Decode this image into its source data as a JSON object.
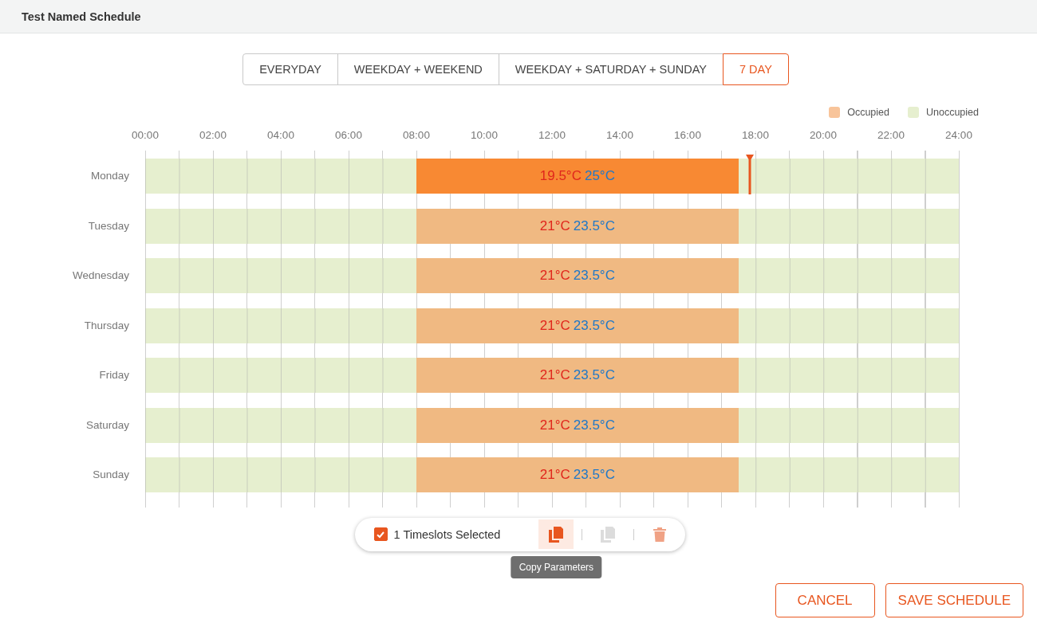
{
  "header": {
    "title": "Test Named Schedule"
  },
  "tabs": [
    {
      "label": "EVERYDAY",
      "selected": false
    },
    {
      "label": "WEEKDAY + WEEKEND",
      "selected": false
    },
    {
      "label": "WEEKDAY + SATURDAY + SUNDAY",
      "selected": false
    },
    {
      "label": "7 DAY",
      "selected": true
    }
  ],
  "legend": [
    {
      "label": "Occupied",
      "color": "#f8c49a"
    },
    {
      "label": "Unoccupied",
      "color": "#e6efcf"
    }
  ],
  "hours": [
    "00:00",
    "02:00",
    "04:00",
    "06:00",
    "08:00",
    "10:00",
    "12:00",
    "14:00",
    "16:00",
    "18:00",
    "20:00",
    "22:00",
    "24:00"
  ],
  "days": [
    {
      "day": "Monday",
      "segments": [
        {
          "kind": "unoccupied",
          "level": 0.333333
        },
        {
          "kind": "occupied",
          "low": "19.5°C",
          "high": "25°C",
          "selected": true
        },
        {
          "kind": "unoccupied",
          "level": 0.270834
        }
      ]
    },
    {
      "day": "Tuesday",
      "segments": [
        {
          "kind": "unoccupied",
          "level": 0.333333
        },
        {
          "kind": "occupied",
          "low": "21°C",
          "high": "23.5°C",
          "selected": false
        },
        {
          "kind": "unoccupied",
          "level": 0.270834
        }
      ]
    },
    {
      "day": "Wednesday",
      "segments": [
        {
          "kind": "unoccupied",
          "level": 0.333333
        },
        {
          "kind": "occupied",
          "low": "21°C",
          "high": "23.5°C",
          "selected": false
        },
        {
          "kind": "unoccupied",
          "level": 0.270834
        }
      ]
    },
    {
      "day": "Thursday",
      "segments": [
        {
          "kind": "unoccupied",
          "level": 0.333333
        },
        {
          "kind": "occupied",
          "low": "21°C",
          "high": "23.5°C",
          "selected": false
        },
        {
          "kind": "unoccupied",
          "level": 0.270834
        }
      ]
    },
    {
      "day": "Friday",
      "segments": [
        {
          "kind": "unoccupied",
          "level": 0.333333
        },
        {
          "kind": "occupied",
          "low": "21°C",
          "high": "23.5°C",
          "selected": false
        },
        {
          "kind": "unoccupied",
          "level": 0.270834
        }
      ]
    },
    {
      "day": "Saturday",
      "segments": [
        {
          "kind": "unoccupied",
          "level": 0.333333
        },
        {
          "kind": "occupied",
          "low": "21°C",
          "high": "23.5°C",
          "selected": false
        },
        {
          "kind": "unoccupied",
          "level": 0.270834
        }
      ]
    },
    {
      "day": "Sunday",
      "segments": [
        {
          "kind": "unoccupied",
          "level": 0.333333
        },
        {
          "kind": "occupied",
          "low": "21°C",
          "high": "23.5°C",
          "selected": false
        },
        {
          "kind": "unoccupied",
          "level": 0.270834
        }
      ]
    }
  ],
  "selection_bar": {
    "checked": true,
    "label": "1 Timeslots Selected",
    "actions": [
      {
        "kind": "copy",
        "disabled": false,
        "hovered": true,
        "tooltip": "Copy Parameters"
      },
      {
        "kind": "paste",
        "disabled": true,
        "hovered": false
      },
      {
        "kind": "delete",
        "disabled": false,
        "hovered": false
      }
    ]
  },
  "buttons": [
    "CANCEL",
    "SAVE SCHEDULE"
  ]
}
